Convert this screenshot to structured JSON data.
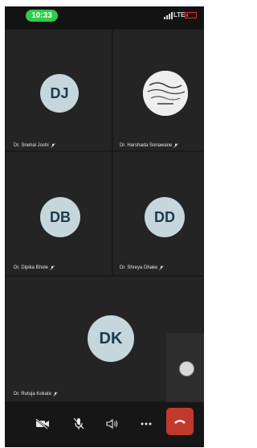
{
  "status_bar": {
    "time": "10:33",
    "network": "LTE",
    "battery_level": 0.2
  },
  "participants": [
    {
      "name": "Dr. Snehal Joshi",
      "initials": "DJ",
      "muted": true,
      "avatar_bg": "#c6d6dd"
    },
    {
      "name": "Dr. Harshada Sonawane",
      "initials": "",
      "muted": true,
      "avatar_kind": "photo"
    },
    {
      "name": "Dr. Dipika Bhole",
      "initials": "DB",
      "muted": true,
      "avatar_bg": "#c6d6dd"
    },
    {
      "name": "Dr. Shreya Dhake",
      "initials": "DD",
      "muted": true,
      "avatar_bg": "#c6d6dd"
    },
    {
      "name": "Dr. Rutuja Kokate",
      "initials": "DK",
      "muted": true,
      "avatar_bg": "#c6d6dd"
    }
  ],
  "controls": [
    "camera-off-icon",
    "mic-off-icon",
    "speaker-icon",
    "more-icon",
    "end-call-icon"
  ],
  "colors": {
    "end_call": "#c0392b",
    "status_pill": "#2ecc4a",
    "tile": "#242424"
  }
}
